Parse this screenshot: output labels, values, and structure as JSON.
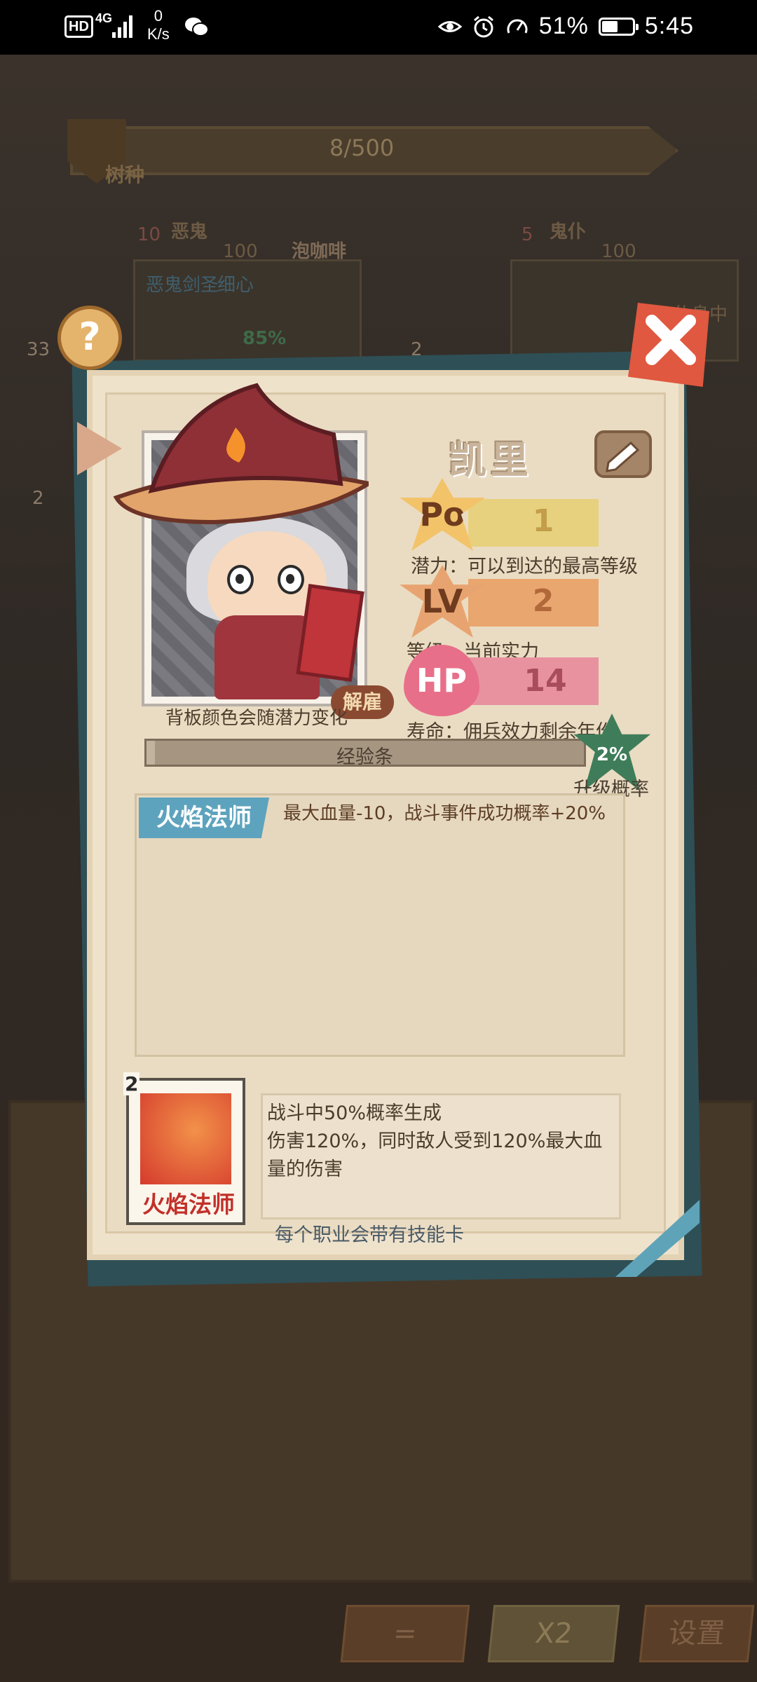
{
  "status_bar": {
    "hd": "HD",
    "network": "4G",
    "speed_value": "0",
    "speed_unit": "K/s",
    "battery": "51%",
    "battery_level": 0.51,
    "time": "5:45",
    "icons": [
      "eye-icon",
      "alarm-icon",
      "speed-icon",
      "wechat-icon"
    ]
  },
  "background": {
    "seed_progress": "8/500",
    "seed_label": "树种",
    "left_card_title": "恶鬼",
    "left_card_level": "10",
    "left_card_hp": "100",
    "left_card_action": "泡咖啡",
    "left_card_sub": "恶鬼剑圣",
    "left_card_sub2": "细心",
    "left_card_pct": "85%",
    "left_badge": "33",
    "left_badge2": "2",
    "right_card_title": "鬼仆",
    "right_card_level": "5",
    "right_card_hp": "100",
    "right_card_status": "休息中",
    "right_badge": "2",
    "bottom_buttons": [
      "=",
      "X2",
      "设置"
    ]
  },
  "popup": {
    "name": "凯里",
    "portrait_note": "背板颜色会随潜力变化",
    "unlock_label": "解雇",
    "stats": [
      {
        "icon_label": "Po",
        "value": "1",
        "desc": "潜力：可以到达的最高等级",
        "color": "#e7d17e"
      },
      {
        "icon_label": "LV",
        "value": "2",
        "desc": "等级：当前实力",
        "color": "#e9a66f"
      },
      {
        "icon_label": "HP",
        "value": "14",
        "desc": "寿命：佣兵效力剩余年份",
        "color": "#e892a0"
      }
    ],
    "exp_label": "经验条",
    "exp_progress": 0.02,
    "upgrade_rate": "2%",
    "upgrade_label": "升级概率",
    "class_name": "火焰法师",
    "class_effect": "最大血量-10，战斗事件成功概率+20%",
    "skill": {
      "count": "2",
      "card_name": "火焰法师",
      "desc_line1": "战斗中50%概率生成",
      "desc_line2": "伤害120%，同时敌人受到120%最大血",
      "desc_line3": "量的伤害",
      "note": "每个职业会带有技能卡"
    }
  }
}
